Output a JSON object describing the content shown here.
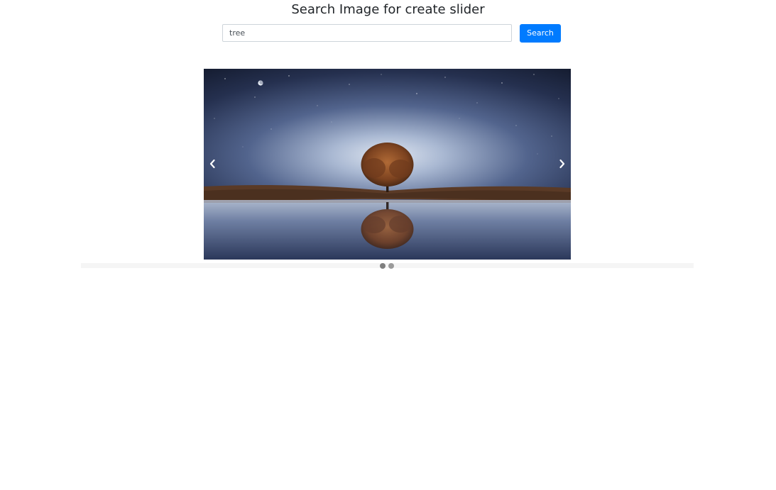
{
  "header": {
    "title": "Search Image for create slider"
  },
  "search": {
    "value": "tree",
    "button_label": "Search"
  },
  "slider": {
    "slide_count": 2,
    "active_index": 0,
    "prev_icon": "chevron-left-icon",
    "next_icon": "chevron-right-icon"
  },
  "colors": {
    "accent": "#007bff",
    "sky_top": "#141a2e",
    "sky_horizon": "#c9d4e6",
    "tree": "#8a4a22"
  }
}
